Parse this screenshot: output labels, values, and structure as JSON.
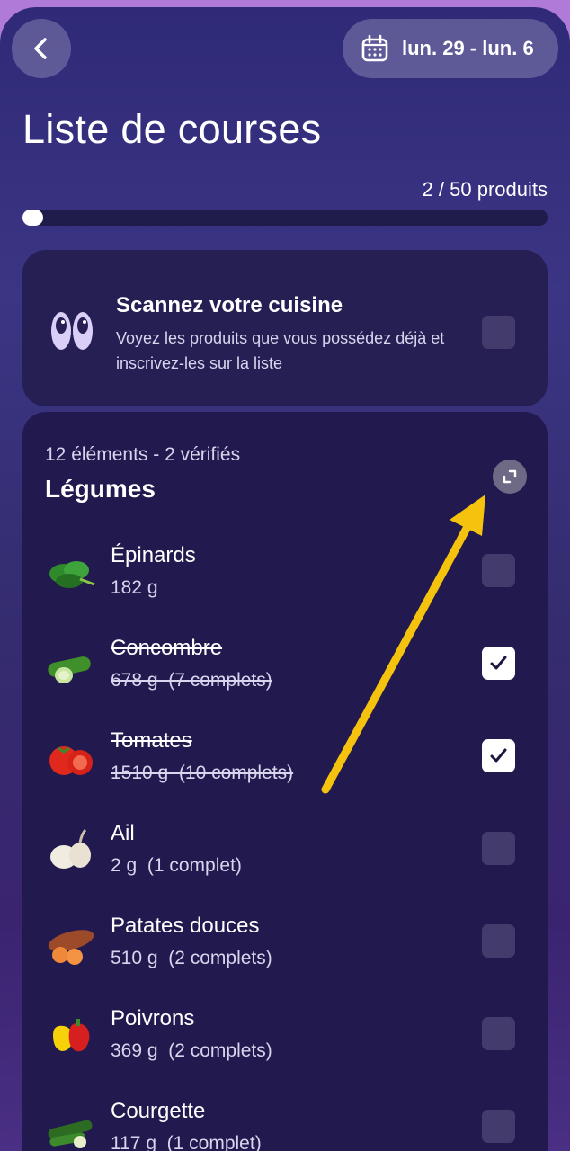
{
  "header": {
    "date_range": "lun. 29 - lun. 6"
  },
  "page_title": "Liste de courses",
  "progress": {
    "text": "2 / 50 produits",
    "value": 0.04
  },
  "scan_card": {
    "title": "Scannez votre cuisine",
    "description": "Voyez les produits que vous possédez déjà et inscrivez-les sur la liste",
    "checked": false
  },
  "category": {
    "meta": "12 éléments - 2 vérifiés",
    "title": "Légumes",
    "items": [
      {
        "name": "Épinards",
        "detail": "182 g",
        "checked": false,
        "icon": "spinach-icon"
      },
      {
        "name": "Concombre",
        "detail": "678 g  (7 complets)",
        "checked": true,
        "icon": "cucumber-icon"
      },
      {
        "name": "Tomates",
        "detail": "1510 g  (10 complets)",
        "checked": true,
        "icon": "tomato-icon"
      },
      {
        "name": "Ail",
        "detail": "2 g  (1 complet)",
        "checked": false,
        "icon": "garlic-icon"
      },
      {
        "name": "Patates douces",
        "detail": "510 g  (2 complets)",
        "checked": false,
        "icon": "sweet-potato-icon"
      },
      {
        "name": "Poivrons",
        "detail": "369 g  (2 complets)",
        "checked": false,
        "icon": "pepper-icon"
      },
      {
        "name": "Courgette",
        "detail": "117 g  (1 complet)",
        "checked": false,
        "icon": "zucchini-icon"
      }
    ]
  },
  "colors": {
    "accent_arrow": "#f5c20e",
    "background": "#2f2a78"
  }
}
